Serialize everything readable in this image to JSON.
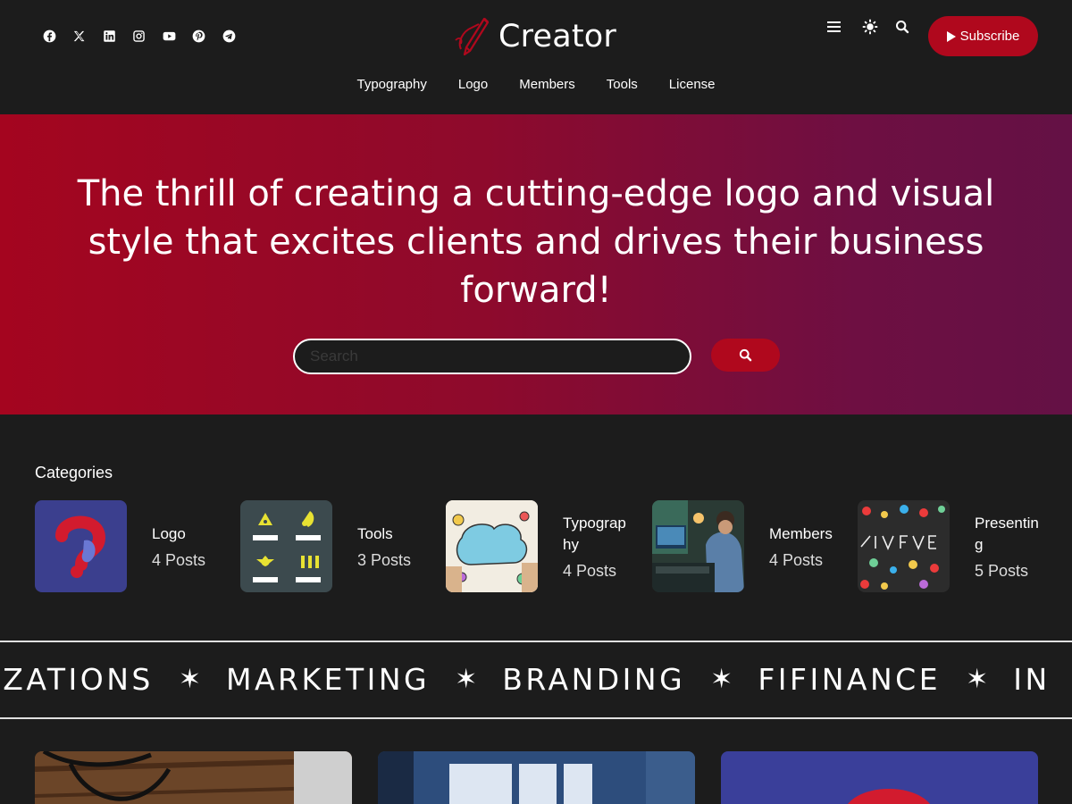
{
  "header": {
    "social_icons": [
      "facebook-icon",
      "x-icon",
      "linkedin-icon",
      "instagram-icon",
      "youtube-icon",
      "pinterest-icon",
      "telegram-icon"
    ],
    "brand": "Creator",
    "tool_icons": [
      "menu-icon",
      "theme-toggle-icon",
      "search-icon"
    ],
    "subscribe_label": "Subscribe"
  },
  "nav": {
    "items": [
      "Typography",
      "Logo",
      "Members",
      "Tools",
      "License"
    ]
  },
  "hero": {
    "headline": "The thrill of creating a cutting-edge logo and visual style that excites clients and drives their business forward!",
    "search_placeholder": "Search",
    "search_icon": "search-icon"
  },
  "categories": {
    "title": "Categories",
    "items": [
      {
        "name": "Logo",
        "count": "4 Posts"
      },
      {
        "name": "Tools",
        "count": "3 Posts"
      },
      {
        "name": "Typography",
        "count": "4 Posts"
      },
      {
        "name": "Members",
        "count": "4 Posts"
      },
      {
        "name": "Presenting",
        "count": "5 Posts"
      }
    ]
  },
  "ticker": {
    "words": [
      "IZATIONS",
      "MARKETING",
      "BRANDING",
      "FIFINANCE",
      "IN"
    ],
    "separator": "✶"
  },
  "colors": {
    "accent": "#b0081d",
    "background": "#1c1c1c",
    "hero_start": "#a4051f",
    "hero_end": "#641145"
  }
}
